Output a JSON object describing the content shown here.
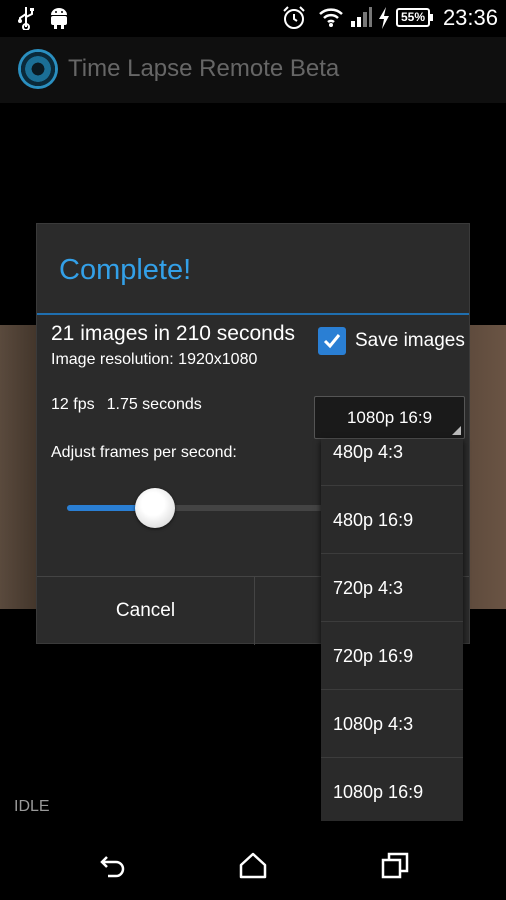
{
  "status_bar": {
    "time": "23:36",
    "battery": "55%",
    "icons": [
      "usb-icon",
      "android-debug-icon",
      "alarm-icon",
      "wifi-icon",
      "signal-icon",
      "charging-icon",
      "battery-icon"
    ]
  },
  "action_bar": {
    "title": "Time Lapse Remote Beta",
    "logo_icon": "camera-lens-icon"
  },
  "background": {
    "status_text": "IDLE"
  },
  "dialog": {
    "title": "Complete!",
    "summary": "21 images in 210 seconds",
    "resolution": "Image resolution: 1920x1080",
    "fps": "12 fps",
    "duration": "1.75 seconds",
    "adjust_label": "Adjust frames per second:",
    "save_images_label": "Save images",
    "save_images_checked": true,
    "slider_fraction": 0.34,
    "cancel_label": "Cancel"
  },
  "format_spinner": {
    "selected": "1080p 16:9",
    "options": [
      "480p 4:3",
      "480p 16:9",
      "720p 4:3",
      "720p 16:9",
      "1080p 4:3",
      "1080p 16:9"
    ]
  },
  "colors": {
    "accent": "#33a0e8",
    "checkbox": "#2a7fd4"
  },
  "nav_bar": {
    "icons": [
      "back-icon",
      "home-icon",
      "recent-apps-icon"
    ]
  }
}
